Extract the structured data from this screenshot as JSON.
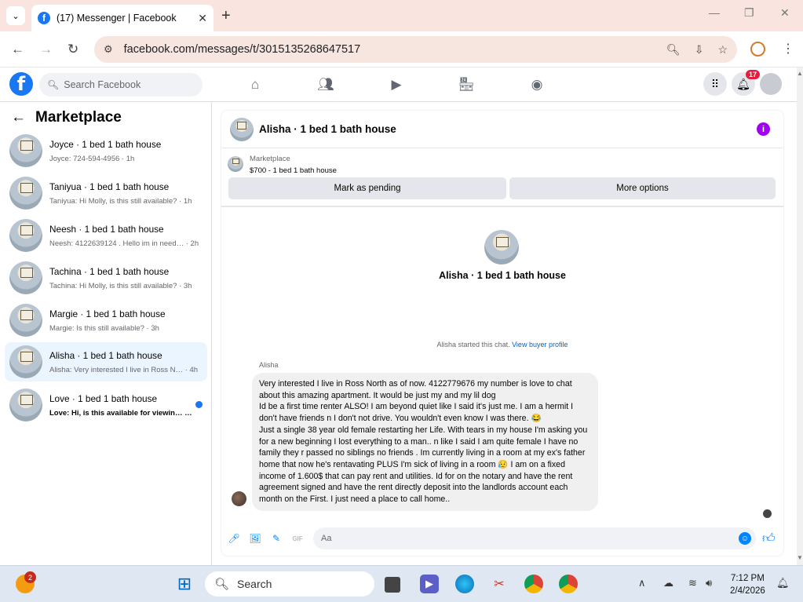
{
  "browser": {
    "tab_title": "(17) Messenger | Facebook",
    "url": "facebook.com/messages/t/3015135268647517"
  },
  "fb": {
    "search_placeholder": "Search Facebook",
    "notification_count": "17"
  },
  "sidebar": {
    "title": "Marketplace",
    "conversations": [
      {
        "name": "Joyce · 1 bed 1 bath house",
        "preview": "Joyce: 724-594-4956 · 1h",
        "selected": false,
        "unread": false
      },
      {
        "name": "Taniyua · 1 bed 1 bath house",
        "preview": "Taniyua: Hi Molly, is this still available? · 1h",
        "selected": false,
        "unread": false
      },
      {
        "name": "Neesh · 1 bed 1 bath house",
        "preview": "Neesh: 4122639124 . Hello im in need… · 2h",
        "selected": false,
        "unread": false
      },
      {
        "name": "Tachina · 1 bed 1 bath house",
        "preview": "Tachina: Hi Molly, is this still available? · 3h",
        "selected": false,
        "unread": false
      },
      {
        "name": "Margie · 1 bed 1 bath house",
        "preview": "Margie: Is this still available? · 3h",
        "selected": false,
        "unread": false
      },
      {
        "name": "Alisha · 1 bed 1 bath house",
        "preview": "Alisha: Very interested I live in Ross N… · 4h",
        "selected": true,
        "unread": false
      },
      {
        "name": "Love · 1 bed 1 bath house",
        "preview": "Love: Hi, is this available for viewin… · 5h",
        "selected": false,
        "unread": true
      }
    ]
  },
  "chat": {
    "title": "Alisha · 1 bed 1 bath house",
    "marketplace_label": "Marketplace",
    "listing": "$700 - 1 bed 1 bath house",
    "btn_pending": "Mark as pending",
    "btn_more": "More options",
    "center_name": "Alisha · 1 bed 1 bath house",
    "started_text": "Alisha started this chat.",
    "view_profile": "View buyer profile",
    "sender": "Alisha",
    "message": "Very interested I live in Ross North as of now. 4122779676 my number is love to chat about this amazing apartment. It would be just my and my lil dog\nId be a first time renter ALSO! I am beyond quiet like I said it's just me. I am a hermit I don't have friends n I don't not drive. You wouldn't even know I was there. 😂\nJust a single 38 year old female restarting her Life. With tears in my house I'm asking you for a new beginning I lost everything to a man.. n like I said I am quite female I have no family they r passed no siblings no friends . Im currently living in a room at my ex's father home that now he's rentavating PLUS I'm sick of living in a room 😥 I am on a fixed income of 1.600$ that can pay rent and utilities. Id for on the notary and have the rent agreement signed and have the rent directly deposit into the landlords account each month on the First. I just need a place to call home..",
    "composer_placeholder": "Aa"
  },
  "taskbar": {
    "search_label": "Search",
    "badge_count": "2",
    "time": "7:12 PM",
    "date": "2/4/2026"
  }
}
